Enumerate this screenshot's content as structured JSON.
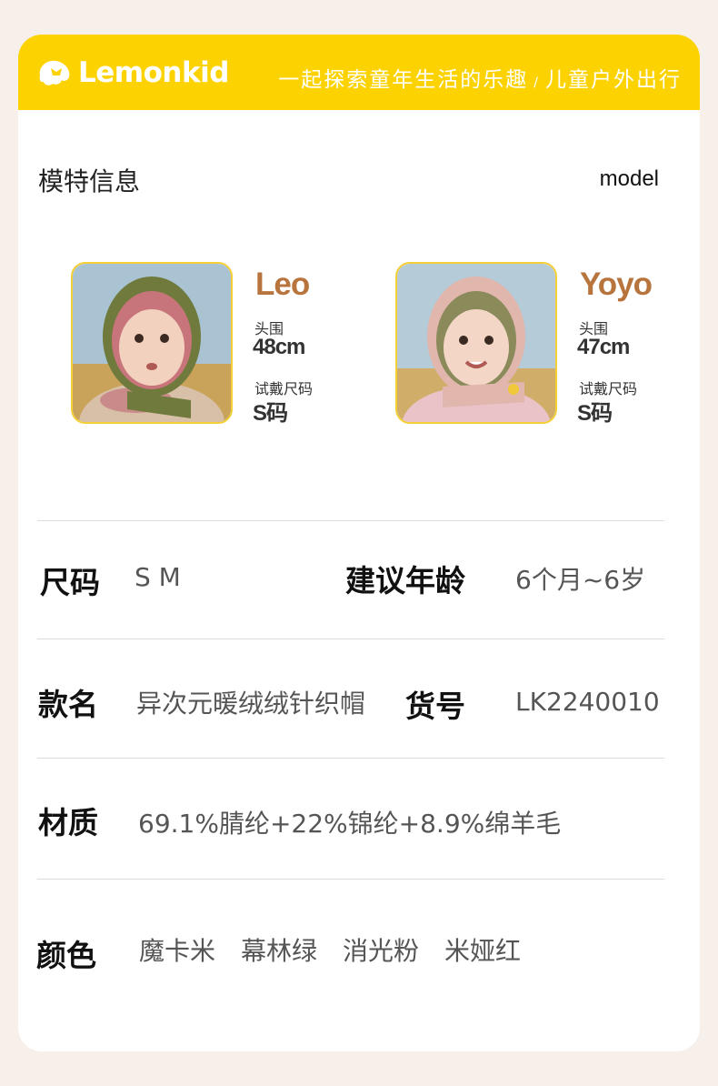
{
  "header": {
    "brand": "Lemonkid",
    "slogan_part1": "一起探索童年生活的乐趣",
    "slogan_sep": "/",
    "slogan_part2": "儿童户外出行",
    "bg_color": "#fcd200"
  },
  "section": {
    "title": "模特信息",
    "title_en": "model"
  },
  "models": [
    {
      "name": "Leo",
      "head_label": "头围",
      "head_value": "48cm",
      "size_label": "试戴尺码",
      "size_value": "S码"
    },
    {
      "name": "Yoyo",
      "head_label": "头围",
      "head_value": "47cm",
      "size_label": "试戴尺码",
      "size_value": "S码"
    }
  ],
  "specs": {
    "size_label": "尺码",
    "size_value": "S  M",
    "age_label": "建议年龄",
    "age_value": "6个月~6岁",
    "name_label": "款名",
    "name_value": "异次元暖绒绒针织帽",
    "sku_label": "货号",
    "sku_value": "LK2240010",
    "material_label": "材质",
    "material_value": "69.1%腈纶+22%锦纶+8.9%绵羊毛",
    "color_label": "颜色",
    "colors": [
      "魔卡米",
      "幕林绿",
      "消光粉",
      "米娅红"
    ]
  },
  "accent_color": "#b8743d"
}
